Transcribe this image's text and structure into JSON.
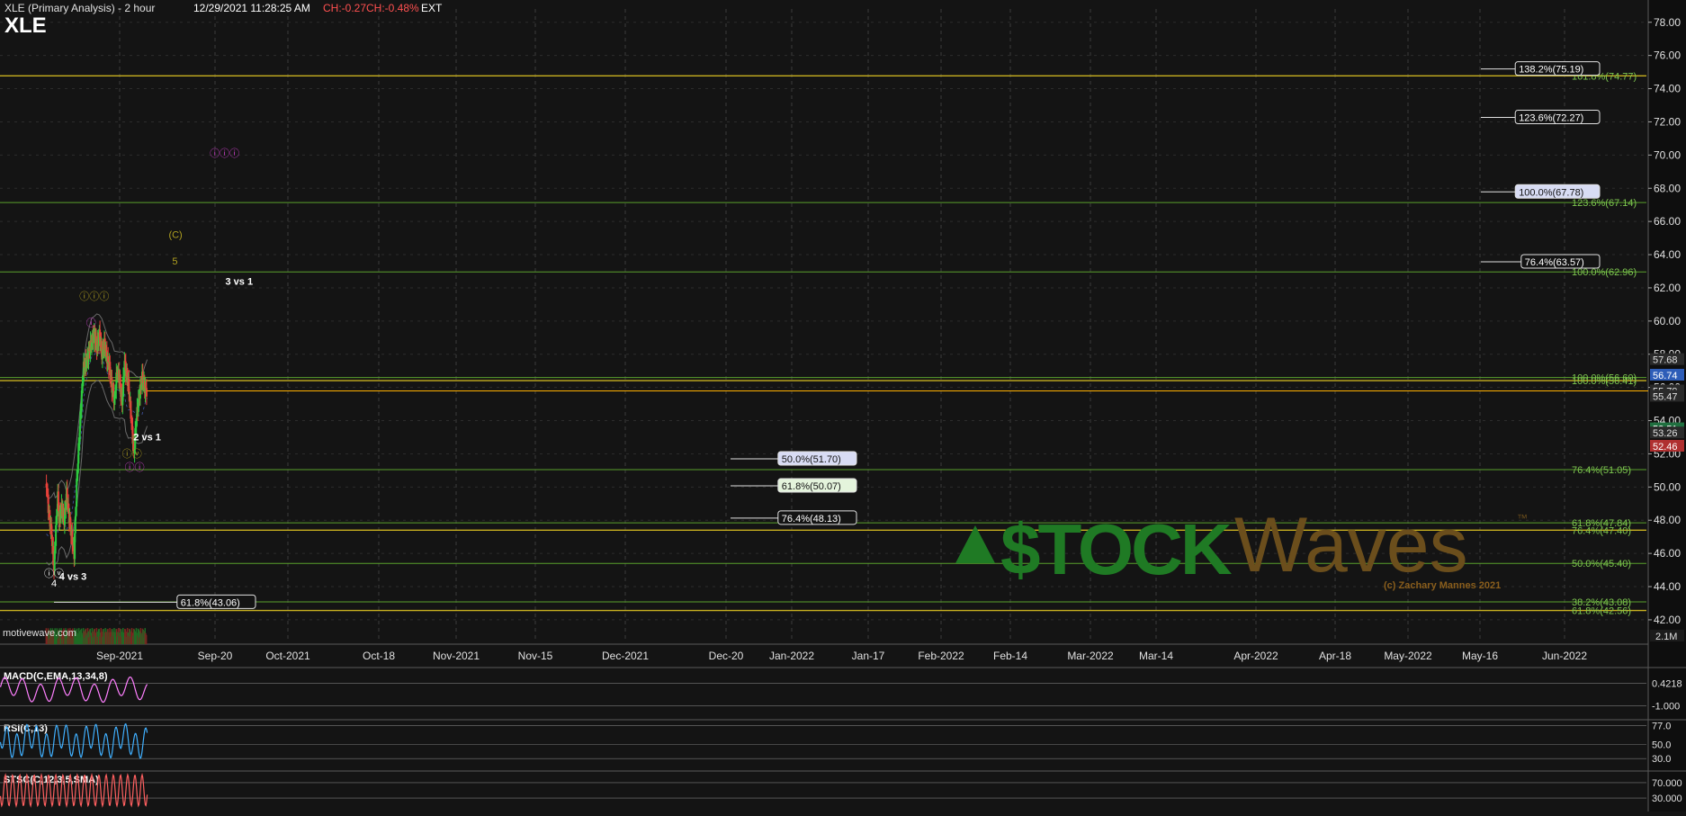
{
  "header": {
    "title": "XLE (Primary Analysis) - 2 hour",
    "datetime": "12/29/2021 11:28:25 AM",
    "change": "CH:-0.27",
    "change_pct": "CH:-0.48%",
    "session": "EXT",
    "symbol": "XLE",
    "watermark_site": "motivewave.com"
  },
  "colors": {
    "background": "#141414",
    "bull_candle": "#2ecc40",
    "bear_candle": "#e8413a",
    "fib_line": "#5aa02c",
    "fib_label": "#7ec850",
    "price_line": "#ffb000",
    "wave_magenta": "#d040d0",
    "wave_olive": "#b0a020",
    "macd": "#ff80ff",
    "rsi": "#40b0ff",
    "stoch": "#ff6060"
  },
  "chart_data": [
    {
      "type": "candlestick",
      "title": "XLE (Primary Analysis) - 2 hour",
      "xlabel": "",
      "ylabel": "",
      "x_ticks": [
        "Sep-2021",
        "Sep-20",
        "Oct-2021",
        "Oct-18",
        "Nov-2021",
        "Nov-15",
        "Dec-2021",
        "Dec-20",
        "Jan-2022",
        "Jan-17",
        "Feb-2022",
        "Feb-14",
        "Mar-2022",
        "Mar-14",
        "Apr-2022",
        "Apr-18",
        "May-2022",
        "May-16",
        "Jun-2022"
      ],
      "y_ticks": [
        "78.00",
        "76.00",
        "74.00",
        "72.00",
        "70.00",
        "68.00",
        "66.00",
        "64.00",
        "62.00",
        "60.00",
        "58.00",
        "56.00",
        "54.00",
        "52.00",
        "50.00",
        "48.00",
        "46.00",
        "44.00",
        "42.00"
      ],
      "ylim": [
        41.4,
        78.8
      ],
      "grid": true,
      "close_series": {
        "x": [
          -12,
          -8,
          -4,
          0,
          2,
          4,
          6,
          8,
          12,
          16,
          20,
          24,
          28,
          32,
          36,
          40,
          44,
          47,
          52,
          56,
          60,
          64,
          68,
          72,
          76,
          80,
          84,
          88,
          92,
          96,
          100,
          104,
          108,
          112,
          114,
          118,
          122,
          127,
          130,
          134,
          140,
          144,
          148
        ],
        "y": [
          50.2,
          48.3,
          47.2,
          45.0,
          46.8,
          48.2,
          49.4,
          48.0,
          48.8,
          48.0,
          49.6,
          48.2,
          47.0,
          46.0,
          50.2,
          53.0,
          55.6,
          57.2,
          57.6,
          58.2,
          58.8,
          59.2,
          58.4,
          59.2,
          58.0,
          58.6,
          57.8,
          57.2,
          56.0,
          55.2,
          57.0,
          56.5,
          55.0,
          57.6,
          57.0,
          56.2,
          54.4,
          52.0,
          53.8,
          55.2,
          56.6,
          56.0,
          55.7
        ]
      },
      "levels": [
        {
          "label": "138.2%(75.19)",
          "value": 75.19
        },
        {
          "label": "123.6%(72.27)",
          "value": 72.27
        },
        {
          "label": "100.0%(67.78)",
          "value": 67.78
        },
        {
          "label": "76.4%(63.57)",
          "value": 63.57
        },
        {
          "label": "50.0%(51.70)",
          "value": 51.7
        },
        {
          "label": "61.8%(50.07)",
          "value": 50.07
        },
        {
          "label": "76.4%(48.13)",
          "value": 48.13
        },
        {
          "label": "61.8%(43.06)",
          "value": 43.06
        }
      ],
      "right_fib_labels": [
        {
          "label": "161.8%(74.77)",
          "value": 74.77
        },
        {
          "label": "123.6%(67.14)",
          "value": 67.14
        },
        {
          "label": "100.0%(62.96)",
          "value": 62.96
        },
        {
          "label": "100.0%(56.60)",
          "value": 56.6
        },
        {
          "label": "100.0%(56.41)",
          "value": 56.41
        },
        {
          "label": "76.4%(51.05)",
          "value": 51.05
        },
        {
          "label": "61.8%(47.84)",
          "value": 47.84
        },
        {
          "label": "76.4%(47.40)",
          "value": 47.4
        },
        {
          "label": "50.0%(45.40)",
          "value": 45.4
        },
        {
          "label": "38.2%(43.08)",
          "value": 43.08
        },
        {
          "label": "61.8%(42.56)",
          "value": 42.56
        }
      ],
      "right_axis_markers": [
        {
          "label": "57.68",
          "value": 57.68,
          "bg": "#2a2a2a",
          "fg": "#e0e0e0"
        },
        {
          "label": "56.74",
          "value": 56.74,
          "bg": "#2e5db8",
          "fg": "#ffffff"
        },
        {
          "label": "55.79",
          "value": 55.79,
          "bg": "#2a2a2a",
          "fg": "#e0e0e0"
        },
        {
          "label": "55.47",
          "value": 55.47,
          "bg": "#2a2a2a",
          "fg": "#e0e0e0"
        },
        {
          "label": "53.51",
          "value": 53.51,
          "bg": "#207040",
          "fg": "#ffffff"
        },
        {
          "label": "53.26",
          "value": 53.26,
          "bg": "#2a2a2a",
          "fg": "#e0e0e0"
        },
        {
          "label": "52.46",
          "value": 52.46,
          "bg": "#b03030",
          "fg": "#ffffff"
        }
      ],
      "wave_labels": [
        {
          "text": "ⓘ",
          "x": 59,
          "y": 59.7,
          "color": "#d040d0"
        },
        {
          "text": "ⓘⓘⓘ",
          "x": 64,
          "y": 61.3,
          "color": "#b0a020"
        },
        {
          "text": "ⓘⓥ",
          "x": 124,
          "y": 51.8,
          "color": "#b0a020"
        },
        {
          "text": "ⓘⓘ",
          "x": 128,
          "y": 51.0,
          "color": "#d040d0"
        },
        {
          "text": "ⓘⓘⓘ",
          "x": 271,
          "y": 69.9,
          "color": "#d040d0"
        },
        {
          "text": "(C)",
          "x": 193,
          "y": 65.0,
          "color": "#b0a020"
        },
        {
          "text": "5",
          "x": 192,
          "y": 63.4,
          "color": "#b0a020"
        },
        {
          "text": "ⓘⓥ",
          "x": 0,
          "y": 44.6,
          "color": "#ffffff"
        },
        {
          "text": "4",
          "x": 0,
          "y": 44.0,
          "color": "#ffffff"
        }
      ],
      "annotations": [
        {
          "text": "3 vs 1",
          "x": 294,
          "y": 62.2
        },
        {
          "text": "2 vs 1",
          "x": 148,
          "y": 52.8
        },
        {
          "text": "4 vs 3",
          "x": 30,
          "y": 44.4
        }
      ],
      "volume_label": "2.1M"
    },
    {
      "type": "line",
      "title": "MACD(C,EMA,13,34,8)",
      "y_ticks": [
        "0.4218",
        "-1.000"
      ],
      "ylim": [
        -1.6,
        1.4
      ]
    },
    {
      "type": "line",
      "title": "RSI(C,13)",
      "y_ticks": [
        "77.0",
        "50.0",
        "30.0"
      ],
      "ylim": [
        15,
        85
      ]
    },
    {
      "type": "line",
      "title": "STSC(C,12,3,5,SMA)",
      "y_ticks": [
        "70.000",
        "30.000"
      ],
      "ylim": [
        0,
        100
      ]
    }
  ],
  "watermark": {
    "brand_s": "$TOCK",
    "brand_w": "Waves",
    "tm": "™",
    "copyright": "(c) Zachary Mannes 2021"
  }
}
